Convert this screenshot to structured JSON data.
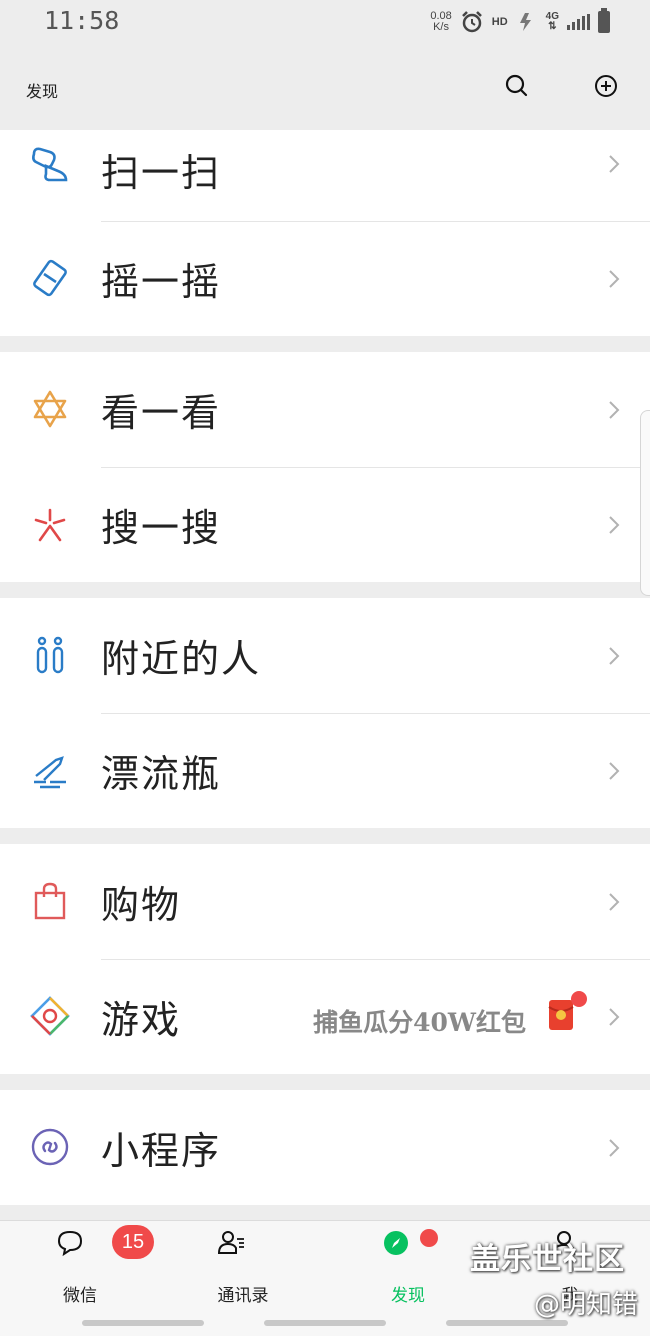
{
  "status_bar": {
    "time": "11:58",
    "net_speed_value": "0.08",
    "net_speed_unit": "K/s",
    "hd_label": "HD",
    "network_label": "4G"
  },
  "header": {
    "title": "发现"
  },
  "groups": [
    {
      "items": [
        {
          "label": "扫一扫"
        },
        {
          "label": "摇一摇"
        }
      ]
    },
    {
      "items": [
        {
          "label": "看一看"
        },
        {
          "label": "搜一搜"
        }
      ]
    },
    {
      "items": [
        {
          "label": "附近的人"
        },
        {
          "label": "漂流瓶"
        }
      ]
    },
    {
      "items": [
        {
          "label": "购物"
        },
        {
          "label": "游戏",
          "extra": "捕鱼瓜分40W红包"
        }
      ]
    },
    {
      "items": [
        {
          "label": "小程序"
        }
      ]
    }
  ],
  "tabbar": {
    "tabs": [
      {
        "label": "微信",
        "badge": "15"
      },
      {
        "label": "通讯录"
      },
      {
        "label": "发现",
        "active": true
      },
      {
        "label": "我"
      }
    ]
  },
  "watermark": {
    "line1": "盖乐世社区",
    "line2": "@明知错"
  },
  "colors": {
    "accent": "#07c160",
    "badge": "#f04a4a",
    "background": "#ededed"
  }
}
